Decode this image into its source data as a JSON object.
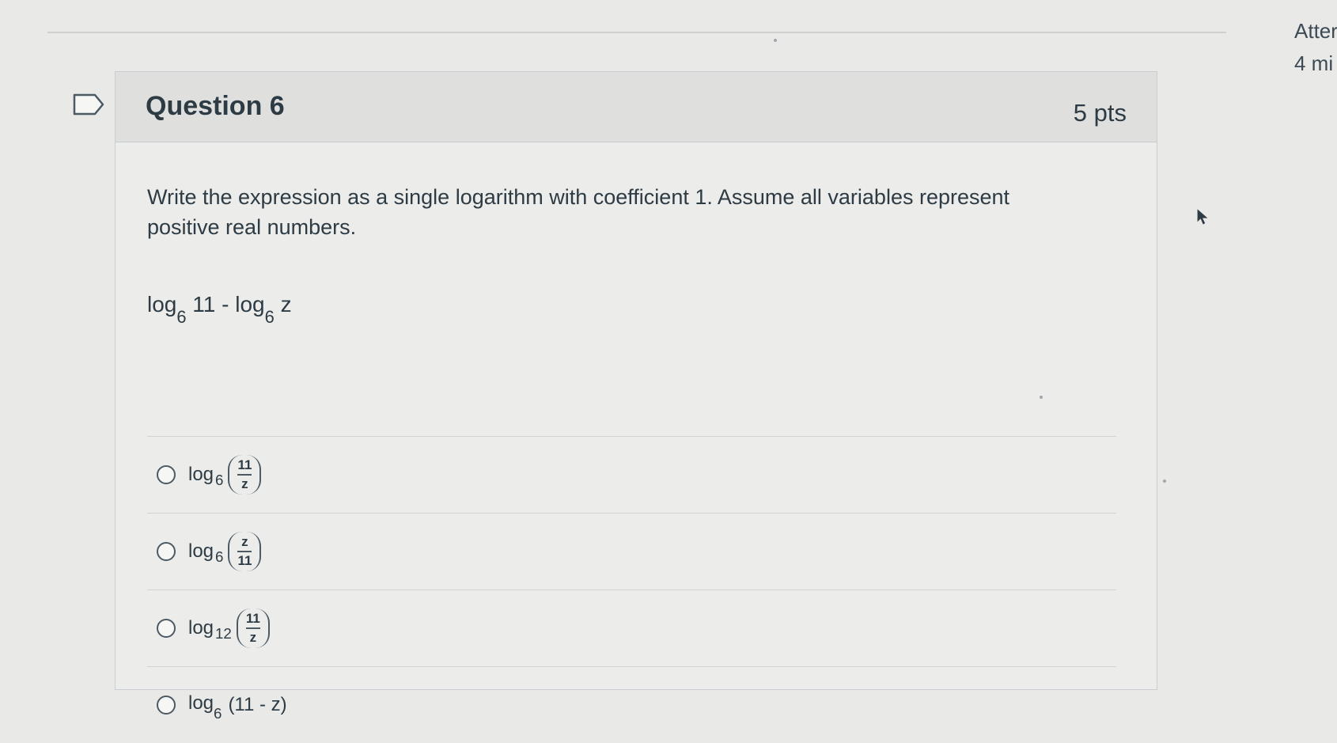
{
  "side_panel": {
    "line1": "Atter",
    "line2": "4 mi"
  },
  "question": {
    "title": "Question 6",
    "points": "5 pts",
    "prompt": "Write the expression as a single logarithm with coefficient 1. Assume all variables represent positive real numbers.",
    "expression": {
      "log1": "log",
      "base1": "6",
      "arg1": "11",
      "minus": "-",
      "log2": "log",
      "base2": "6",
      "arg2": "z"
    },
    "answers": [
      {
        "log": "log",
        "base": "6",
        "numerator": "11",
        "denominator": "z"
      },
      {
        "log": "log",
        "base": "6",
        "numerator": "z",
        "denominator": "11"
      },
      {
        "log": "log",
        "base": "12",
        "numerator": "11",
        "denominator": "z"
      },
      {
        "log": "log",
        "base": "6",
        "expr": "(11 - z)"
      }
    ]
  }
}
